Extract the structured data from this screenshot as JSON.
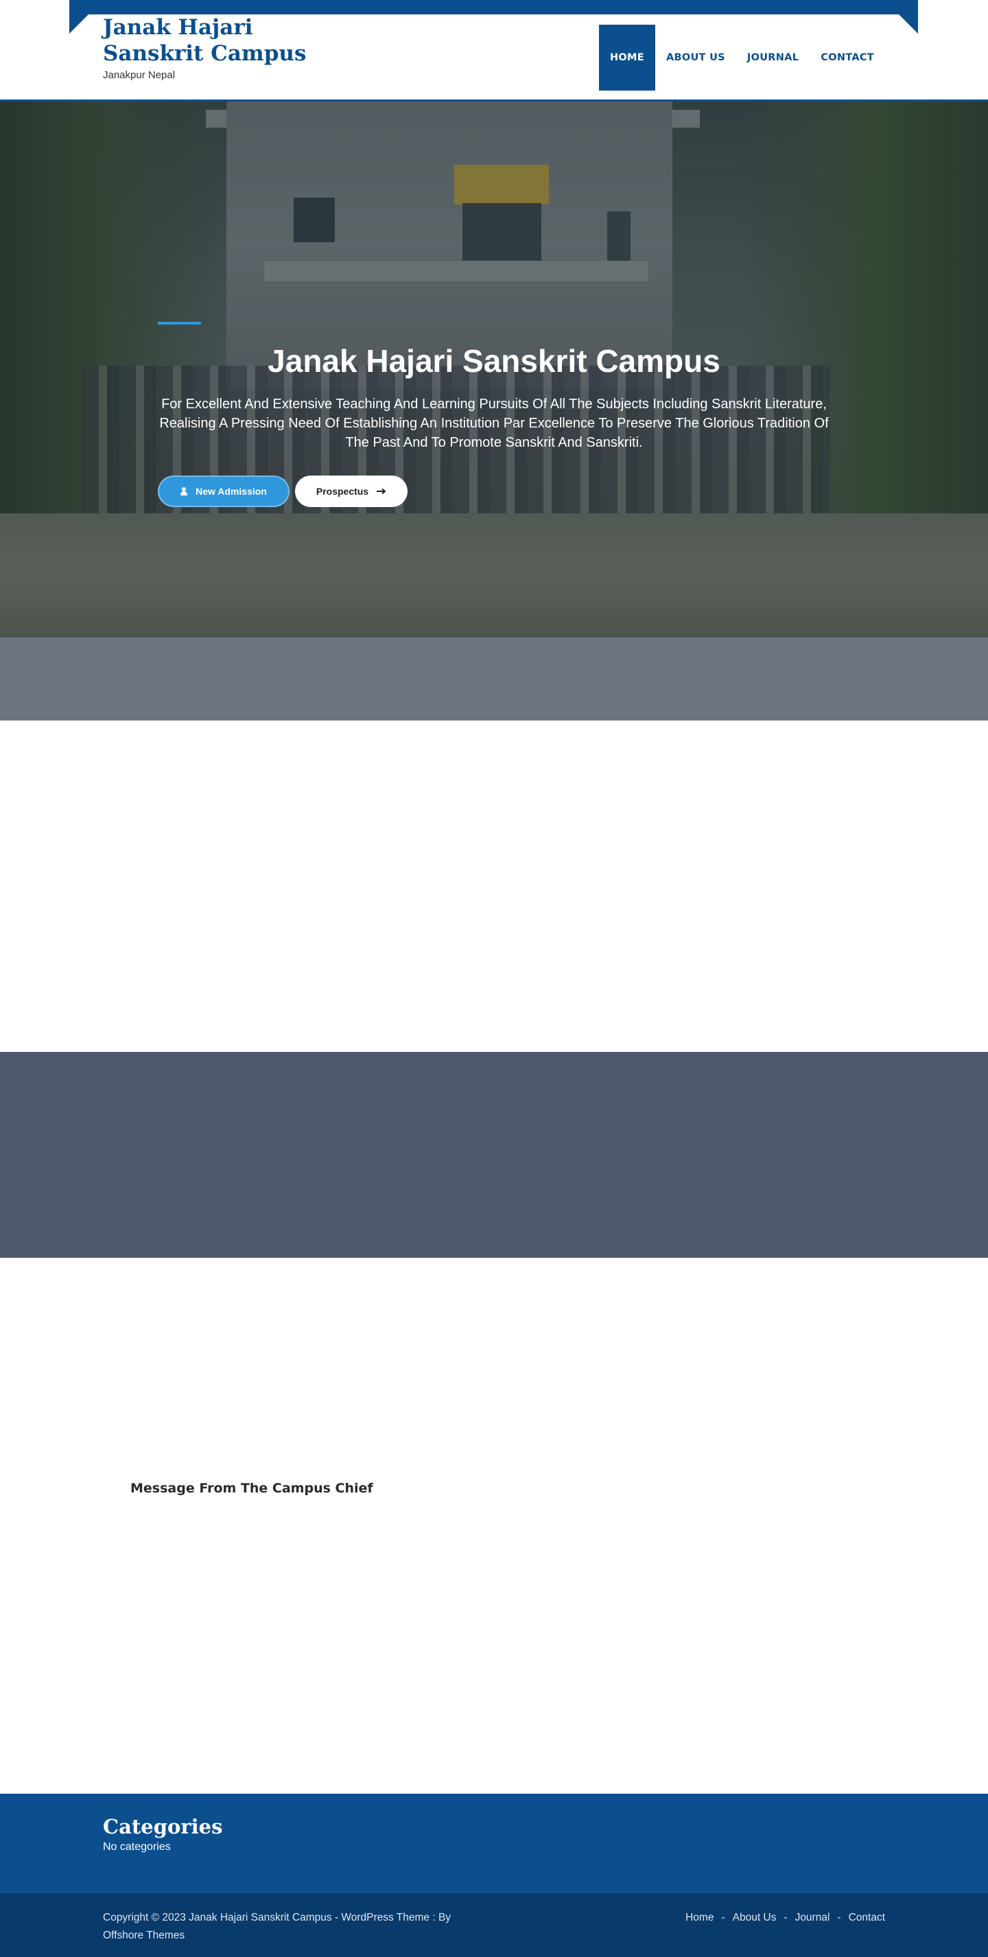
{
  "site": {
    "title": "Janak Hajari Sanskrit Campus",
    "tagline": "Janakpur Nepal"
  },
  "nav": {
    "items": [
      {
        "label": "HOME",
        "active": true
      },
      {
        "label": "ABOUT US",
        "active": false
      },
      {
        "label": "JOURNAL",
        "active": false
      },
      {
        "label": "CONTACT",
        "active": false
      }
    ]
  },
  "hero": {
    "title": "Janak Hajari Sanskrit Campus",
    "description": "For Excellent And Extensive Teaching And Learning Pursuits Of All The Subjects Including Sanskrit Literature, Realising A Pressing Need Of Establishing An Institution Par Excellence To Preserve The Glorious Tradition Of The Past And To Promote Sanskrit And Sanskriti.",
    "buttons": {
      "admission": {
        "label": "New Admission",
        "icon": "user-icon"
      },
      "prospectus": {
        "label": "Prospectus",
        "icon": "arrow-right-icon"
      }
    }
  },
  "message": {
    "title": "Message From The Campus Chief"
  },
  "footer": {
    "categories_title": "Categories",
    "categories_empty": "No categories",
    "copyright": "Copyright © 2023 Janak Hajari Sanskrit Campus - WordPress Theme : By Offshore Themes",
    "links": [
      "Home",
      "About Us",
      "Journal",
      "Contact"
    ]
  },
  "colors": {
    "brand": "#0b4f8f",
    "accent": "#2f97dc",
    "footer_bottom": "#083a6c"
  }
}
